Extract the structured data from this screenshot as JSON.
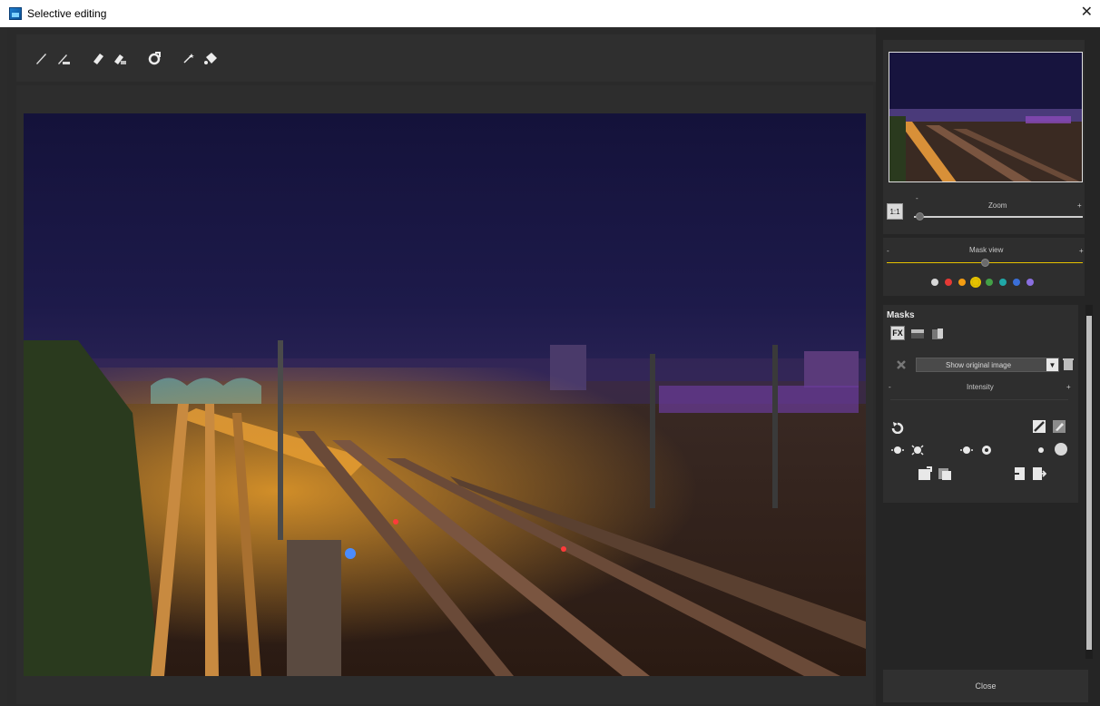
{
  "window": {
    "title": "Selective editing",
    "close_glyph": "✕"
  },
  "toolbar": {
    "tools": [
      "brush-icon",
      "brush-erase-icon",
      "eraser-icon",
      "eraser-fill-icon",
      "auto-mask-icon",
      "magic-wand-icon",
      "fill-bucket-icon"
    ]
  },
  "navigator": {
    "zoom_button": "1:1",
    "zoom_label": "Zoom",
    "zoom_minus": "-",
    "zoom_plus": "+",
    "zoom_level": 0.03
  },
  "mask_view": {
    "label": "Mask view",
    "minus": "-",
    "plus": "+",
    "level": 0.5,
    "colors": [
      "#d8d8d8",
      "#e53935",
      "#f39c12",
      "#e6c200",
      "#43a047",
      "#20a8a8",
      "#3a6fd8",
      "#8a6fe0"
    ],
    "selected_index": 3
  },
  "masks": {
    "title": "Masks",
    "fx_label": "FX",
    "dropdown_value": "Show original image",
    "intensity_label": "Intensity",
    "intensity_minus": "-",
    "intensity_plus": "+"
  },
  "footer": {
    "close_label": "Close"
  },
  "colors": {
    "accent": "#e6c200",
    "panel": "#2e2e2e",
    "background": "#252525"
  }
}
